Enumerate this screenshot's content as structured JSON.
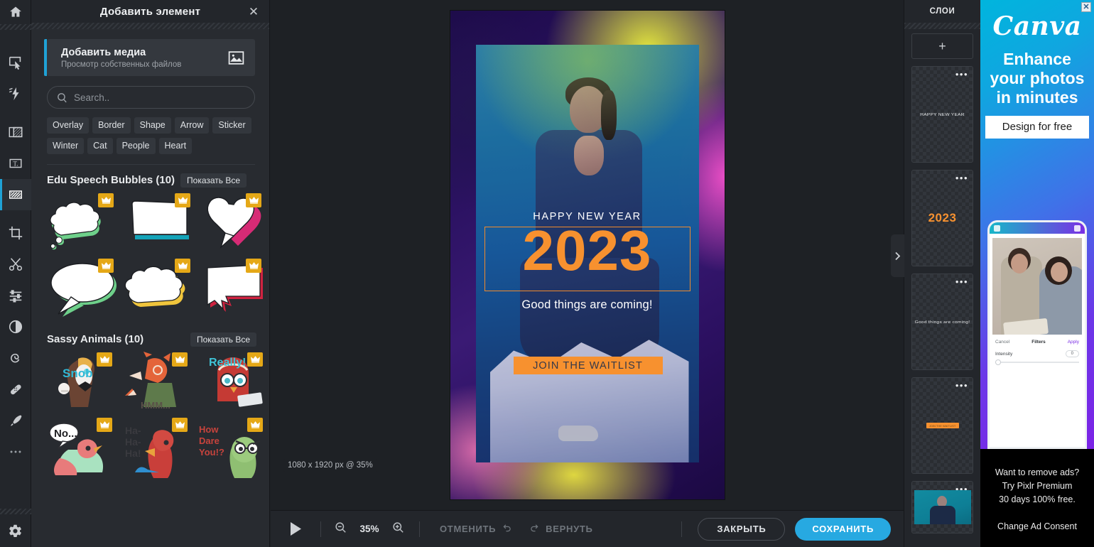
{
  "toolbar": {
    "home_icon": "home-icon",
    "tools": [
      {
        "name": "arrange-tool",
        "icon": "cursor-select-icon"
      },
      {
        "name": "cutout-tool",
        "icon": "lightning-icon"
      },
      {
        "name": "layout-tool",
        "icon": "layout-icon"
      },
      {
        "name": "text-tool",
        "icon": "text-box-icon"
      },
      {
        "name": "element-tool",
        "icon": "hatched-square-icon",
        "active": true
      },
      {
        "name": "crop-tool",
        "icon": "crop-icon"
      },
      {
        "name": "cutout-scissors-tool",
        "icon": "scissors-icon"
      },
      {
        "name": "adjust-tool",
        "icon": "sliders-icon"
      },
      {
        "name": "effects-tool",
        "icon": "contrast-circle-icon"
      },
      {
        "name": "liquify-tool",
        "icon": "spiral-icon"
      },
      {
        "name": "retouch-tool",
        "icon": "bandage-icon"
      },
      {
        "name": "draw-tool",
        "icon": "brush-icon"
      },
      {
        "name": "more-tools",
        "icon": "ellipsis-icon"
      }
    ],
    "settings_icon": "gear-icon"
  },
  "panel": {
    "title": "Добавить элемент",
    "close_icon": "close-icon",
    "media_card": {
      "title": "Добавить медиа",
      "subtitle": "Просмотр собственных файлов",
      "icon": "image-icon"
    },
    "search": {
      "placeholder": "Search..",
      "value": "",
      "icon": "search-icon"
    },
    "chips": [
      "Overlay",
      "Border",
      "Shape",
      "Arrow",
      "Sticker",
      "Winter",
      "Cat",
      "People",
      "Heart"
    ],
    "sections": [
      {
        "title": "Edu Speech Bubbles (10)",
        "show_all": "Показать Все",
        "items": [
          {
            "name": "cloud-bubble-green",
            "premium": true
          },
          {
            "name": "rect-bubble-teal",
            "premium": true
          },
          {
            "name": "heart-bubble-pink",
            "premium": true
          },
          {
            "name": "oval-bubble-green",
            "premium": true
          },
          {
            "name": "cloud-bubble-yellow",
            "premium": true
          },
          {
            "name": "burst-bubble-red",
            "premium": true
          }
        ]
      },
      {
        "title": "Sassy Animals (10)",
        "show_all": "Показать Все",
        "items": [
          {
            "name": "snob-dog-sticker",
            "label": "Snob",
            "premium": true
          },
          {
            "name": "hmm-fox-sticker",
            "label": "HMM...",
            "premium": true
          },
          {
            "name": "really-owl-sticker",
            "label": "Really!",
            "premium": true
          },
          {
            "name": "no-flamingo-sticker",
            "label": "No...",
            "premium": true
          },
          {
            "name": "haha-parrot-sticker",
            "label": "Ha-Ha-Ha!",
            "premium": true
          },
          {
            "name": "how-dare-you-turtle-sticker",
            "label": "How Dare You!?",
            "premium": true
          }
        ]
      }
    ]
  },
  "canvas": {
    "size_badge": "1080 x 1920 px @ 35%",
    "collapse_icon": "chevron-right-icon",
    "artwork": {
      "headline": "HAPPY NEW YEAR",
      "year": "2023",
      "tagline": "Good things are coming!",
      "cta": "JOIN THE WAITLIST",
      "accent_color": "#f7912f"
    }
  },
  "bottombar": {
    "play_icon": "play-icon",
    "zoom_out_icon": "zoom-out-icon",
    "zoom_in_icon": "zoom-in-icon",
    "zoom_level": "35%",
    "undo_label": "ОТМЕНИТЬ",
    "undo_icon": "undo-arrow-icon",
    "redo_label": "ВЕРНУТЬ",
    "redo_icon": "redo-arrow-icon",
    "close_label": "ЗАКРЫТЬ",
    "save_label": "СОХРАНИТЬ",
    "save_color": "#27a9e1"
  },
  "layers": {
    "title": "слои",
    "add_label": "+",
    "menu_icon": "ellipsis-icon",
    "items": [
      {
        "name": "layer-happy-new-year",
        "kind": "text",
        "preview": "HAPPY NEW YEAR"
      },
      {
        "name": "layer-2023",
        "kind": "text",
        "preview": "2023"
      },
      {
        "name": "layer-good-things",
        "kind": "text",
        "preview": "Good things are coming!"
      },
      {
        "name": "layer-join-waitlist",
        "kind": "shape",
        "preview": "JOIN THE WAITLIST"
      },
      {
        "name": "layer-photo",
        "kind": "image",
        "preview": ""
      }
    ]
  },
  "ad": {
    "close_icon": "close-icon",
    "brand": "Canva",
    "headline": "Enhance your photos in minutes",
    "cta": "Design for free",
    "phone": {
      "cancel": "Cancel",
      "title": "Filters",
      "apply": "Apply",
      "intensity_label": "Intensity",
      "intensity_value": "0"
    },
    "footer_line1": "Want to remove ads?",
    "footer_line2": "Try Pixlr Premium",
    "footer_line3": "30 days 100% free.",
    "consent": "Change Ad Consent"
  }
}
